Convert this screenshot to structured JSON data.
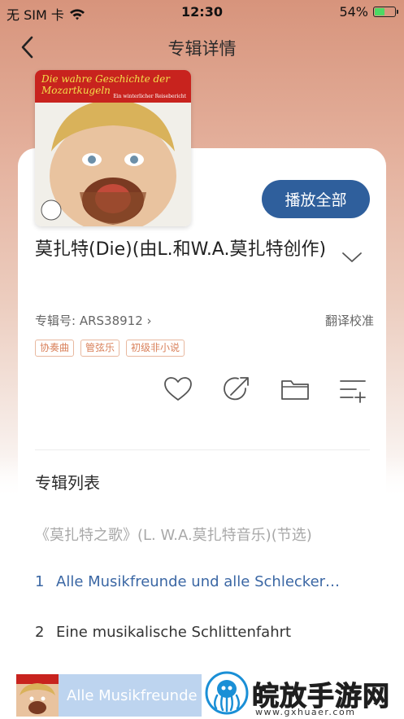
{
  "status_bar": {
    "carrier": "无 SIM 卡",
    "time": "12:30",
    "battery_percent": "54%",
    "battery_level": 0.54,
    "wifi_icon": "wifi-icon"
  },
  "nav": {
    "title": "专辑详情",
    "back_icon": "chevron-left-icon"
  },
  "album": {
    "cover_title": "Die wahre Geschichte der Mozartkugeln",
    "cover_subtitle": "Ein winterlicher Reisebericht",
    "title": "莫扎特(Die)(由L.和W.A.莫扎特创作)",
    "album_no_label": "专辑号: ARS38912",
    "album_no_chevron": "›",
    "translate_label": "翻译校准",
    "play_all_label": "播放全部",
    "tags": [
      "协奏曲",
      "管弦乐",
      "初级非小说"
    ]
  },
  "actions": [
    "heart-icon",
    "share-icon",
    "folder-icon",
    "add-to-playlist-icon"
  ],
  "list": {
    "section_title": "专辑列表",
    "group_title": "《莫扎特之歌》(L. W.A.莫扎特音乐)(节选)",
    "tracks": [
      {
        "num": "1",
        "title": "Alle Musikfreunde und alle Schlecker…",
        "active": true
      },
      {
        "num": "2",
        "title": "Eine musikalische Schlittenfahrt",
        "active": false
      }
    ]
  },
  "mini_player": {
    "title": "Alle Musikfreunde"
  },
  "watermark": {
    "text": "皖放手游网",
    "url": "www.gxhuaer.com"
  },
  "colors": {
    "accent": "#2f5f9c",
    "active_track": "#3b67a4",
    "tag_text": "#d9805a",
    "tag_border": "#e8b89f",
    "header_gradient_top": "#d7947c",
    "battery_green": "#4cd964"
  }
}
